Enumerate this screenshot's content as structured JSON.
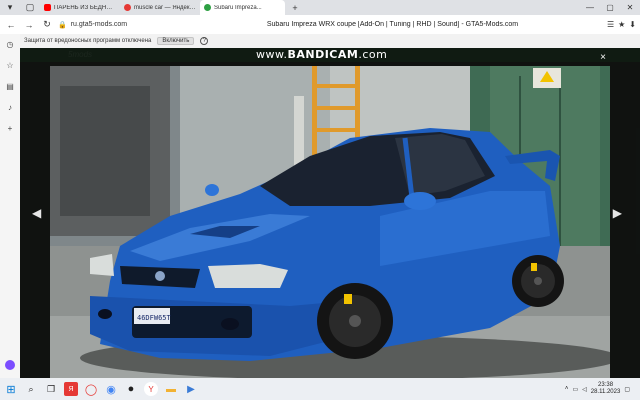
{
  "tabs": [
    {
      "label": "ПАРЕНЬ ИЗ БЕДНОЙ СЕ...",
      "color": "#ff0000",
      "icon": "youtube-icon"
    },
    {
      "label": "muscle car — Яндекс на...",
      "color": "#e53935",
      "icon": "yandex-icon"
    },
    {
      "label": "Subaru Impreza...",
      "color": "#2ea043",
      "icon": "gta5mods-icon",
      "active": true
    }
  ],
  "address": "ru.gta5-mods.com",
  "page_title": "Subaru Impreza WRX coupe [Add-On | Tuning | RHD | Sound] - GTA5-Mods.com",
  "protection": {
    "text": "Защита от вредоносных программ отключена",
    "enable_label": "Включить",
    "help": "?"
  },
  "watermark": {
    "prefix": "www.",
    "brand": "BANDICAM",
    "suffix": ".com"
  },
  "lightbox": {
    "close": "×",
    "prev": "◀",
    "next": "▶"
  },
  "car": {
    "plate": "46DFW65T",
    "body_color": "#1f5fc0"
  },
  "taskbar": {
    "time": "23:38",
    "date": "28.11.2023",
    "apps": [
      "search-icon",
      "taskview-icon",
      "yandex-icon",
      "opera-icon",
      "chrome-icon",
      "obs-icon",
      "yandex-browser-icon",
      "files-icon",
      "media-icon"
    ]
  }
}
